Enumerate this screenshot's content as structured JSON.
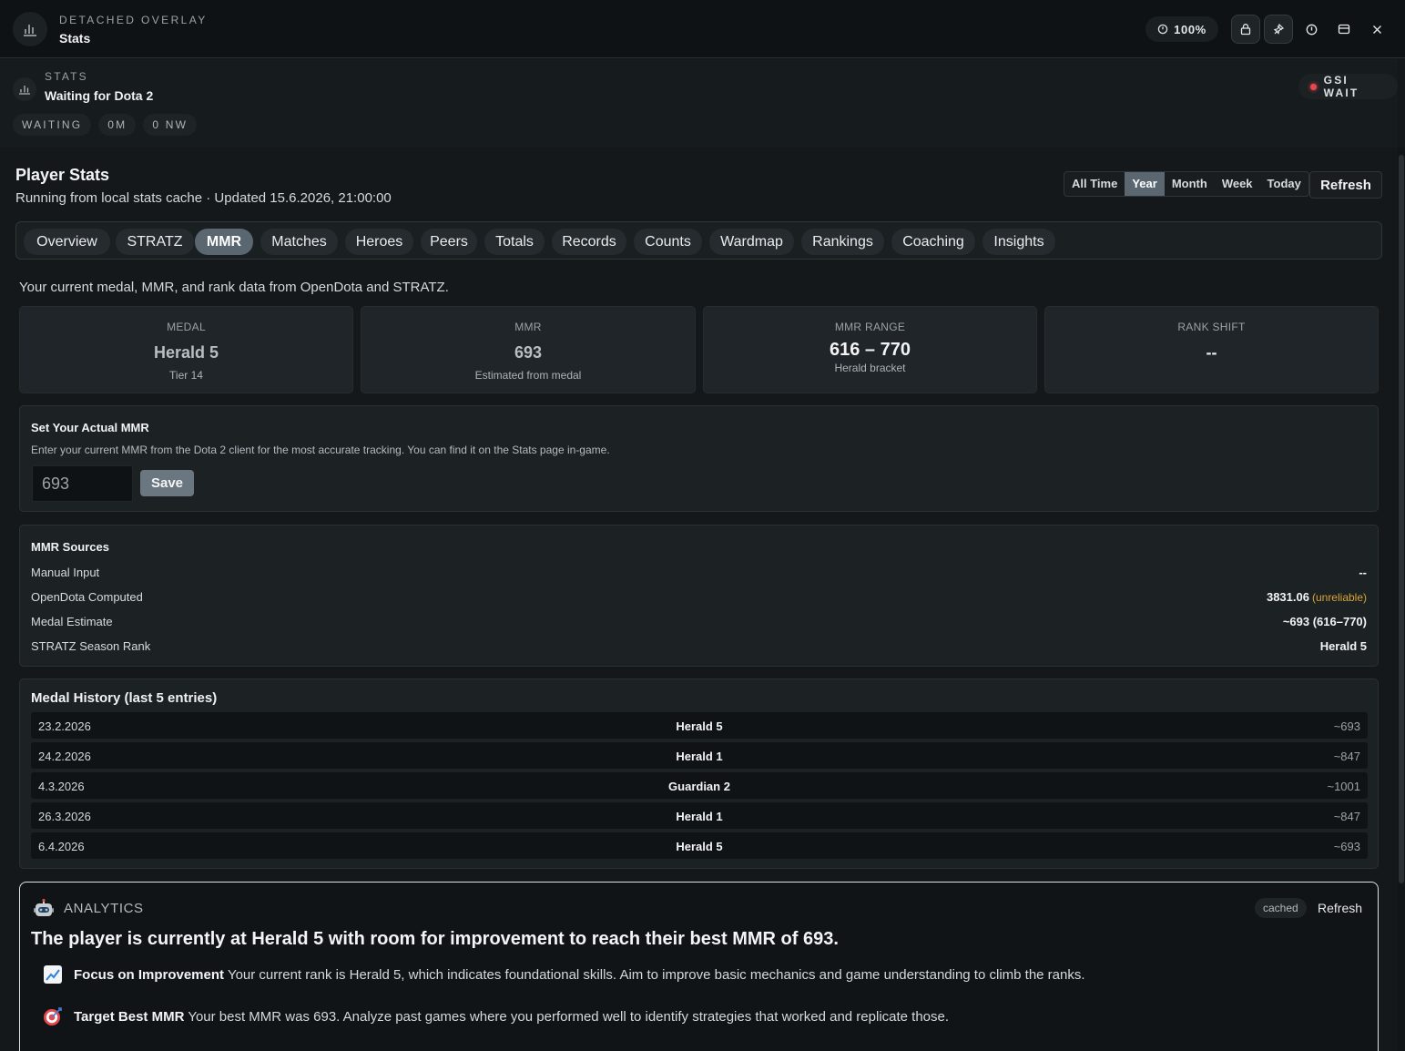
{
  "titlebar": {
    "subtitle": "DETACHED OVERLAY",
    "title": "Stats",
    "zoom": "100%",
    "icons": [
      "bar-chart-icon",
      "lock-icon",
      "pin-icon",
      "info-icon",
      "window-icon",
      "close-icon"
    ]
  },
  "overlay": {
    "subtitle": "STATS",
    "title": "Waiting for Dota 2",
    "chips": [
      "WAITING",
      "0M",
      "0 NW"
    ],
    "gsi_status": "GSI WAIT",
    "gsi_color": "#e5484d"
  },
  "header": {
    "title": "Player Stats",
    "subtitle": "Running from local stats cache · Updated 15.6.2026, 21:00:00",
    "ranges": [
      "All Time",
      "Year",
      "Month",
      "Week",
      "Today"
    ],
    "active_range": "Year",
    "refresh_label": "Refresh"
  },
  "tabs": [
    "Overview",
    "STRATZ",
    "MMR",
    "Matches",
    "Heroes",
    "Peers",
    "Totals",
    "Records",
    "Counts",
    "Wardmap",
    "Rankings",
    "Coaching",
    "Insights"
  ],
  "active_tab": "MMR",
  "mmr": {
    "description": "Your current medal, MMR, and rank data from OpenDota and STRATZ.",
    "cards": [
      {
        "label": "MEDAL",
        "value": "Herald 5",
        "note": "Tier 14"
      },
      {
        "label": "MMR",
        "value": "693",
        "note": "Estimated from medal"
      },
      {
        "label": "MMR RANGE",
        "value": "616 – 770",
        "note": "Herald bracket"
      },
      {
        "label": "RANK SHIFT",
        "value": "--",
        "note": ""
      }
    ],
    "set_actual": {
      "title": "Set Your Actual MMR",
      "description": "Enter your current MMR from the Dota 2 client for the most accurate tracking. You can find it on the Stats page in-game.",
      "input_value": "693",
      "save_label": "Save"
    },
    "sources": {
      "title": "MMR Sources",
      "rows": [
        {
          "label": "Manual Input",
          "value": "--",
          "note": ""
        },
        {
          "label": "OpenDota Computed",
          "value": "3831.06",
          "note": "(unreliable)"
        },
        {
          "label": "Medal Estimate",
          "value": "~693 (616–770)",
          "note": ""
        },
        {
          "label": "STRATZ Season Rank",
          "value": "Herald 5",
          "note": ""
        }
      ]
    },
    "history": {
      "title": "Medal History (last 5 entries)",
      "rows": [
        {
          "date": "23.2.2026",
          "medal": "Herald 5",
          "mmr": "~693"
        },
        {
          "date": "24.2.2026",
          "medal": "Herald 1",
          "mmr": "~847"
        },
        {
          "date": "4.3.2026",
          "medal": "Guardian 2",
          "mmr": "~1001"
        },
        {
          "date": "26.3.2026",
          "medal": "Herald 1",
          "mmr": "~847"
        },
        {
          "date": "6.4.2026",
          "medal": "Herald 5",
          "mmr": "~693"
        }
      ]
    }
  },
  "analytics": {
    "label": "ANALYTICS",
    "cached": "cached",
    "refresh_label": "Refresh",
    "summary": "The player is currently at Herald 5 with room for improvement to reach their best MMR of 693.",
    "items": [
      {
        "icon": "chart-increasing-icon",
        "title": "Focus on Improvement",
        "text": "Your current rank is Herald 5, which indicates foundational skills. Aim to improve basic mechanics and game understanding to climb the ranks."
      },
      {
        "icon": "target-icon",
        "title": "Target Best MMR",
        "text": "Your best MMR was 693. Analyze past games where you performed well to identify strategies that worked and replicate those."
      }
    ]
  }
}
